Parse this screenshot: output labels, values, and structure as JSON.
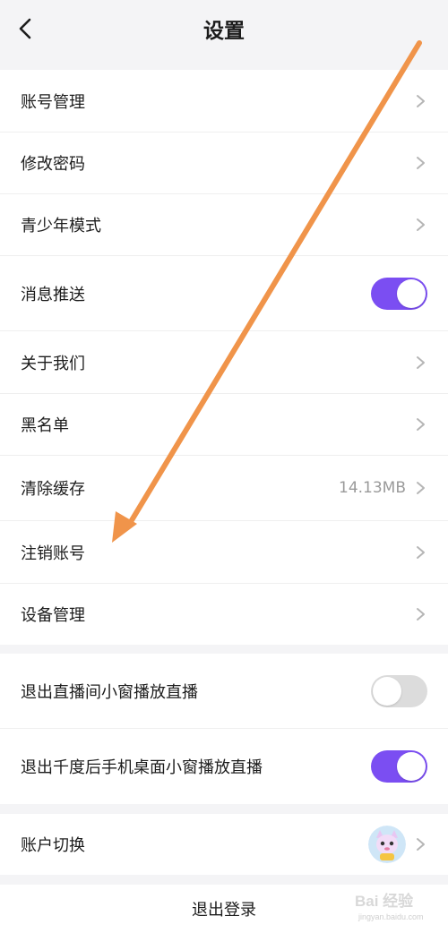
{
  "header": {
    "title": "设置",
    "back_icon": "chevron-left-icon"
  },
  "group1": {
    "account_management": "账号管理",
    "change_password": "修改密码",
    "teen_mode": "青少年模式",
    "push_notifications": {
      "label": "消息推送",
      "enabled": true
    },
    "about_us": "关于我们",
    "blacklist": "黑名单",
    "clear_cache": {
      "label": "清除缓存",
      "value": "14.13MB"
    },
    "cancel_account": "注销账号",
    "device_management": "设备管理"
  },
  "group2": {
    "exit_room_pip": {
      "label": "退出直播间小窗播放直播",
      "enabled": false
    },
    "exit_app_pip": {
      "label": "退出千度后手机桌面小窗播放直播",
      "enabled": true
    }
  },
  "group3": {
    "switch_account": "账户切换",
    "avatar_icon": "cartoon-avatar-icon"
  },
  "logout": {
    "label": "退出登录"
  },
  "watermark": {
    "text": "Bai 经验",
    "url": "jingyan.baidu.com"
  },
  "colors": {
    "accent": "#7b4ef2",
    "arrow": "#f0944a",
    "background": "#f4f4f6"
  }
}
